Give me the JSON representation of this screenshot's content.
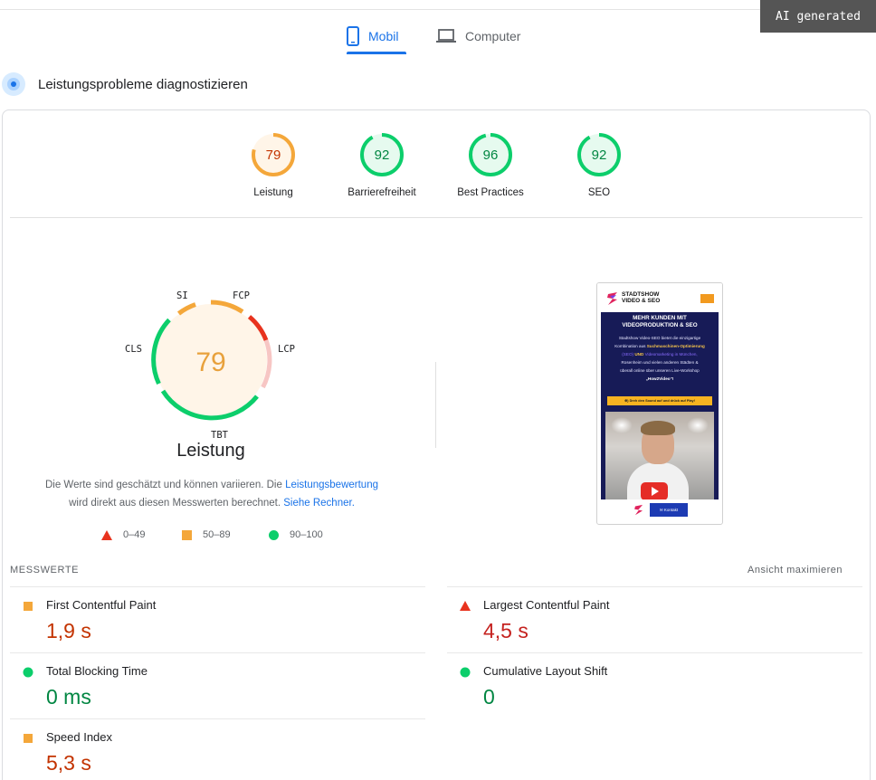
{
  "badge": "AI generated",
  "tabs": [
    {
      "label": "Mobil",
      "icon": "smartphone-icon",
      "active": true
    },
    {
      "label": "Computer",
      "icon": "laptop-icon",
      "active": false
    }
  ],
  "section_title": "Leistungsprobleme diagnostizieren",
  "categories": [
    {
      "score": "79",
      "label": "Leistung",
      "status": "average",
      "color": "#f4a73a"
    },
    {
      "score": "92",
      "label": "Barrierefreiheit",
      "status": "pass",
      "color": "#0cce6b"
    },
    {
      "score": "96",
      "label": "Best Practices",
      "status": "pass",
      "color": "#0cce6b"
    },
    {
      "score": "92",
      "label": "SEO",
      "status": "pass",
      "color": "#0cce6b"
    }
  ],
  "performance": {
    "score": "79",
    "title": "Leistung",
    "metric_tags": {
      "si": "SI",
      "fcp": "FCP",
      "lcp": "LCP",
      "tbt": "TBT",
      "cls": "CLS"
    },
    "note_part1": "Die Werte sind geschätzt und können variieren. Die ",
    "note_link1": "Leistungsbewertung",
    "note_part2": "wird direkt aus diesen Messwerten berechnet. ",
    "note_link2": "Siehe Rechner."
  },
  "legend": [
    {
      "range": "0–49",
      "shape": "triangle",
      "color": "#e8331e"
    },
    {
      "range": "50–89",
      "shape": "square",
      "color": "#f4a73a"
    },
    {
      "range": "90–100",
      "shape": "circle",
      "color": "#0cce6b"
    }
  ],
  "screenshot": {
    "brand_line1": "STADTSHOW",
    "brand_line2": "VIDEO & SEO",
    "headline_line1": "MEHR KUNDEN MIT",
    "headline_line2": "VIDEOPRODUKTION & SEO",
    "body_1": "Stadtshow Video-SEO bietet die einzigartige",
    "body_2a": "Kombination aus ",
    "body_2b": "Suchmaschinen-Optimierung",
    "body_3a": "(SEO)",
    "body_3b": " UND ",
    "body_3c": "Videomarketing in München,",
    "body_4": "Rosenheim und vielen anderen Städten &",
    "body_5": "überall online über unseren Live-Workshop",
    "body_6": "„How2Video“!",
    "cta": "⊕) Dreh den Sound auf und drück auf Play!",
    "contact": "✉ Kontakt"
  },
  "metrics_section": {
    "title": "MESSWERTE",
    "expand": "Ansicht maximieren"
  },
  "metrics": [
    {
      "label": "First Contentful Paint",
      "value": "1,9 s",
      "status": "average"
    },
    {
      "label": "Largest Contentful Paint",
      "value": "4,5 s",
      "status": "fail"
    },
    {
      "label": "Total Blocking Time",
      "value": "0 ms",
      "status": "pass"
    },
    {
      "label": "Cumulative Layout Shift",
      "value": "0",
      "status": "pass"
    },
    {
      "label": "Speed Index",
      "value": "5,3 s",
      "status": "average"
    }
  ]
}
